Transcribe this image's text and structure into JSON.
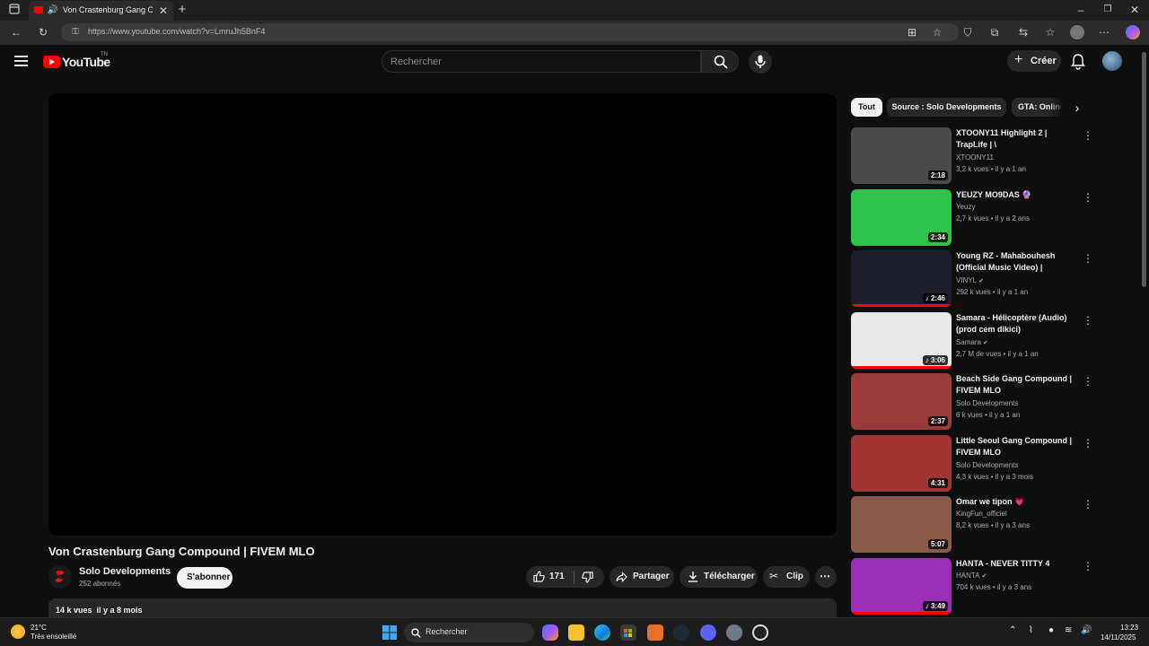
{
  "browser": {
    "tab_title": "Von Crastenburg Gang Comp",
    "url": "https://www.youtube.com/watch?v=LmruJh5BnF4"
  },
  "header": {
    "logo": "YouTube",
    "logo_sup": "TN",
    "search_placeholder": "Rechercher",
    "create_label": "Créer"
  },
  "video": {
    "title": "Von Crastenburg Gang Compound | FIVEM MLO",
    "channel": "Solo Developments",
    "subscribers": "252 abonnés",
    "subscribe_label": "S'abonner",
    "likes": "171",
    "share_label": "Partager",
    "download_label": "Télécharger",
    "clip_label": "Clip",
    "views_date": "14 k vues  il y a 8 mois"
  },
  "chips": [
    "Tout",
    "Source : Solo Developments",
    "GTA: Online"
  ],
  "recommendations": [
    {
      "title": "XTOONY11 Highlight 2 | TrapLife | \\",
      "channel": "XTOONY11",
      "verified": false,
      "meta": "3,2 k vues • il y a 1 an",
      "duration": "2:18",
      "music": false,
      "progress": 0,
      "thumb_color": "#4a4a4a"
    },
    {
      "title": "YEUZY MO9DAS 🔮",
      "channel": "Yeuzy",
      "verified": false,
      "meta": "2,7 k vues • il y a 2 ans",
      "duration": "2:34",
      "music": false,
      "progress": 0,
      "thumb_color": "#2fc24a"
    },
    {
      "title": "Young RZ - Mahabouhesh (Official Music Video) | محبوهاش",
      "channel": "VINYL",
      "verified": true,
      "meta": "292 k vues • il y a 1 an",
      "duration": "2:46",
      "music": true,
      "progress": 1.0,
      "thumb_color": "#1d1d2b"
    },
    {
      "title": "Samara - Hélicoptère (Audio) (prod cem dikici)",
      "channel": "Samara",
      "verified": true,
      "meta": "2,7 M de vues • il y a 1 an",
      "duration": "3:06",
      "music": true,
      "progress": 1.0,
      "thumb_color": "#e8e8e8"
    },
    {
      "title": "Beach Side Gang Compound | FIVEM MLO",
      "channel": "Solo Developments",
      "verified": false,
      "meta": "6 k vues • il y a 1 an",
      "duration": "2:37",
      "music": false,
      "progress": 0,
      "thumb_color": "#9a3b3b"
    },
    {
      "title": "Little Seoul Gang Compound | FIVEM MLO",
      "channel": "Solo Developments",
      "verified": false,
      "meta": "4,3 k vues • il y a 3 mois",
      "duration": "4:31",
      "music": false,
      "progress": 0,
      "thumb_color": "#a13434"
    },
    {
      "title": "Omar we tipon 💗",
      "channel": "KingFun_officiel",
      "verified": false,
      "meta": "8,2 k vues • il y a 3 ans",
      "duration": "5:07",
      "music": false,
      "progress": 0,
      "thumb_color": "#8b5a4a"
    },
    {
      "title": "HANTA - NEVER TITTY 4",
      "channel": "HANTA",
      "verified": true,
      "meta": "704 k vues • il y a 3 ans",
      "duration": "3:49",
      "music": true,
      "progress": 1.0,
      "thumb_color": "#9c2fb8"
    }
  ],
  "taskbar": {
    "weather_temp": "21°C",
    "weather_desc": "Très ensoleillé",
    "search_placeholder": "Rechercher",
    "time": "13:23",
    "date": "14/11/2025"
  },
  "colors": {
    "brand": "#ff0000",
    "background": "#0f0f0f",
    "surface": "#272727"
  }
}
